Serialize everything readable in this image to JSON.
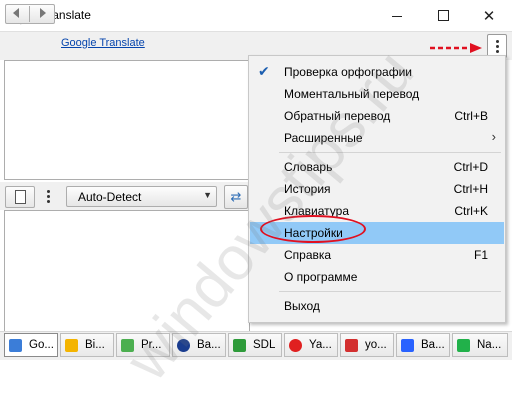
{
  "window": {
    "title": "QTranslate"
  },
  "toolbar": {
    "service_link": "Google Translate"
  },
  "source_panel": {
    "language": "Auto-Detect"
  },
  "menu": {
    "items": [
      {
        "label": "Проверка орфографии",
        "shortcut": "",
        "checked": true
      },
      {
        "label": "Моментальный перевод",
        "shortcut": ""
      },
      {
        "label": "Обратный перевод",
        "shortcut": "Ctrl+B"
      },
      {
        "label": "Расширенные",
        "shortcut": "",
        "submenu": true
      },
      {
        "label": "Словарь",
        "shortcut": "Ctrl+D"
      },
      {
        "label": "История",
        "shortcut": "Ctrl+H"
      },
      {
        "label": "Клавиатура",
        "shortcut": "Ctrl+K"
      },
      {
        "label": "Настройки",
        "shortcut": "",
        "highlighted": true
      },
      {
        "label": "Справка",
        "shortcut": "F1"
      },
      {
        "label": "О программе",
        "shortcut": ""
      },
      {
        "label": "Выход",
        "shortcut": ""
      }
    ]
  },
  "tabs": [
    {
      "label": "Go...",
      "icon": "google-icon",
      "color": "#3b7dd8",
      "active": true
    },
    {
      "label": "Bi...",
      "icon": "bing-icon",
      "color": "#f4b400"
    },
    {
      "label": "Pr...",
      "icon": "promt-icon",
      "color": "#4caf50"
    },
    {
      "label": "Ba...",
      "icon": "babylon-icon",
      "color": "#1a3d8f"
    },
    {
      "label": "SDL",
      "icon": "sdl-icon",
      "color": "#2e9b3a"
    },
    {
      "label": "Ya...",
      "icon": "yandex-icon",
      "color": "#e02020"
    },
    {
      "label": "yo...",
      "icon": "youdao-icon",
      "color": "#d32f2f"
    },
    {
      "label": "Ba...",
      "icon": "baidu-icon",
      "color": "#2962ff"
    },
    {
      "label": "Na...",
      "icon": "naver-icon",
      "color": "#21b14a"
    }
  ],
  "watermark": {
    "text": "windowstips.ru"
  },
  "colors": {
    "highlight": "#91c9f7",
    "annotation_red": "#e01020",
    "link": "#0645ad"
  }
}
